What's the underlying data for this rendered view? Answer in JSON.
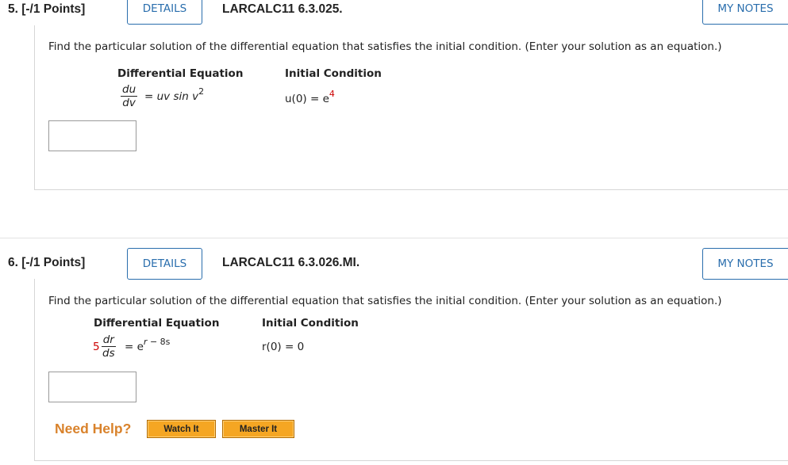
{
  "questions": [
    {
      "number_label": "5. [-/1 Points]",
      "details_label": "DETAILS",
      "code": "LARCALC11 6.3.025.",
      "notes_label": "MY NOTES",
      "prompt": "Find the particular solution of the differential equation that satisfies the initial condition. (Enter your solution as an equation.)",
      "col1_header": "Differential Equation",
      "col2_header": "Initial Condition",
      "de": {
        "num": "du",
        "den": "dv",
        "rhs": "= uv sin v",
        "rhs_exp": "2"
      },
      "ic": {
        "lhs": "u(0) = e",
        "exp": "4"
      },
      "answer_value": ""
    },
    {
      "number_label": "6. [-/1 Points]",
      "details_label": "DETAILS",
      "code": "LARCALC11 6.3.026.MI.",
      "notes_label": "MY NOTES",
      "prompt": "Find the particular solution of the differential equation that satisfies the initial condition. (Enter your solution as an equation.)",
      "col1_header": "Differential Equation",
      "col2_header": "Initial Condition",
      "de": {
        "coef": "5",
        "num": "dr",
        "den": "ds",
        "rhs": "= e",
        "rhs_exp_var": "r",
        "rhs_exp_rest": " − 8s"
      },
      "ic": {
        "lhs": "r(0) = 0"
      },
      "answer_value": "",
      "help": {
        "label": "Need Help?",
        "watch": "Watch It",
        "master": "Master It"
      }
    }
  ],
  "colors": {
    "accent_blue": "#2a6ead",
    "help_orange": "#d9822b",
    "button_orange": "#f5a623",
    "highlight_red": "#cc0000"
  }
}
